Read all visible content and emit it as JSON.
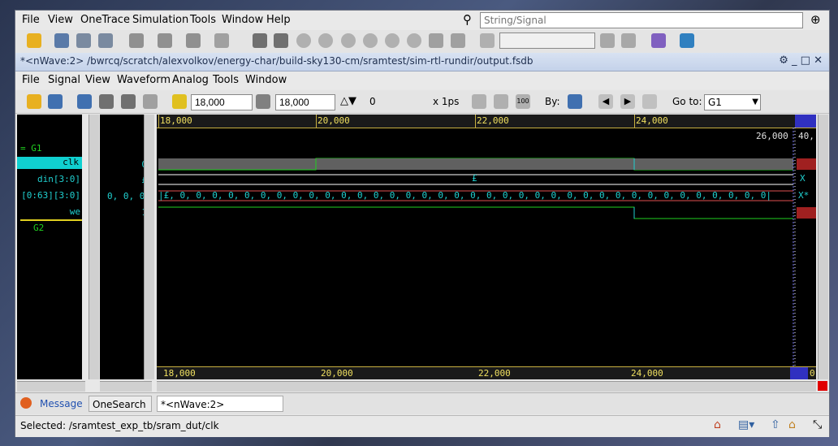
{
  "main_menu": [
    "File",
    "View",
    "OneTrace",
    "Simulation",
    "Tools",
    "Window",
    "Help"
  ],
  "search": {
    "placeholder": "String/Signal"
  },
  "window_title": "*<nWave:2> /bwrcq/scratch/alexvolkov/energy-char/build-sky130-cm/sramtest/sim-rtl-rundir/output.fsdb",
  "nwave_menu": [
    "File",
    "Signal",
    "View",
    "Waveform",
    "Analog",
    "Tools",
    "Window"
  ],
  "toolbar2": {
    "cursor_time": "18,000",
    "marker_time": "18,000",
    "delta": "0",
    "scale": "x 1ps",
    "by_label": "By:",
    "goto_label": "Go to:",
    "goto_value": "G1"
  },
  "signals": {
    "group1": "G1",
    "clk": "clk",
    "din": "din[3:0]",
    "mem": "[0:63][3:0]",
    "we": "we",
    "group2": "G2"
  },
  "values": {
    "clk": "0",
    "din": "£",
    "mem": "0, 0, 0|",
    "we": "1"
  },
  "ruler": {
    "labels": [
      "18,000",
      "20,000",
      "22,000",
      "24,000"
    ],
    "cursor_label": "26,000",
    "cursor_suffix": "40,"
  },
  "waves": {
    "din_value": "£",
    "mem_value": "|£, 0, 0, 0, 0, 0, 0, 0, 0, 0, 0, 0, 0, 0, 0, 0, 0, 0, 0, 0, 0, 0, 0, 0, 0, 0, 0, 0, 0, 0, 0, 0, 0, 0, 0, 0, 0, 0|",
    "mem_tail": "X*",
    "din_tail": "X",
    "bottom_right": "0"
  },
  "tabs": {
    "message": "Message",
    "onesearch": "OneSearch",
    "nwave": "*<nWave:2> output.fsdb"
  },
  "status": "Selected: /sramtest_exp_tb/sram_dut/clk",
  "colors": {
    "wave_green": "#20d020",
    "wave_cyan": "#20d0d0",
    "bus_white": "#ffffff",
    "ruler_yellow": "#f0e060",
    "bg": "#000000"
  }
}
